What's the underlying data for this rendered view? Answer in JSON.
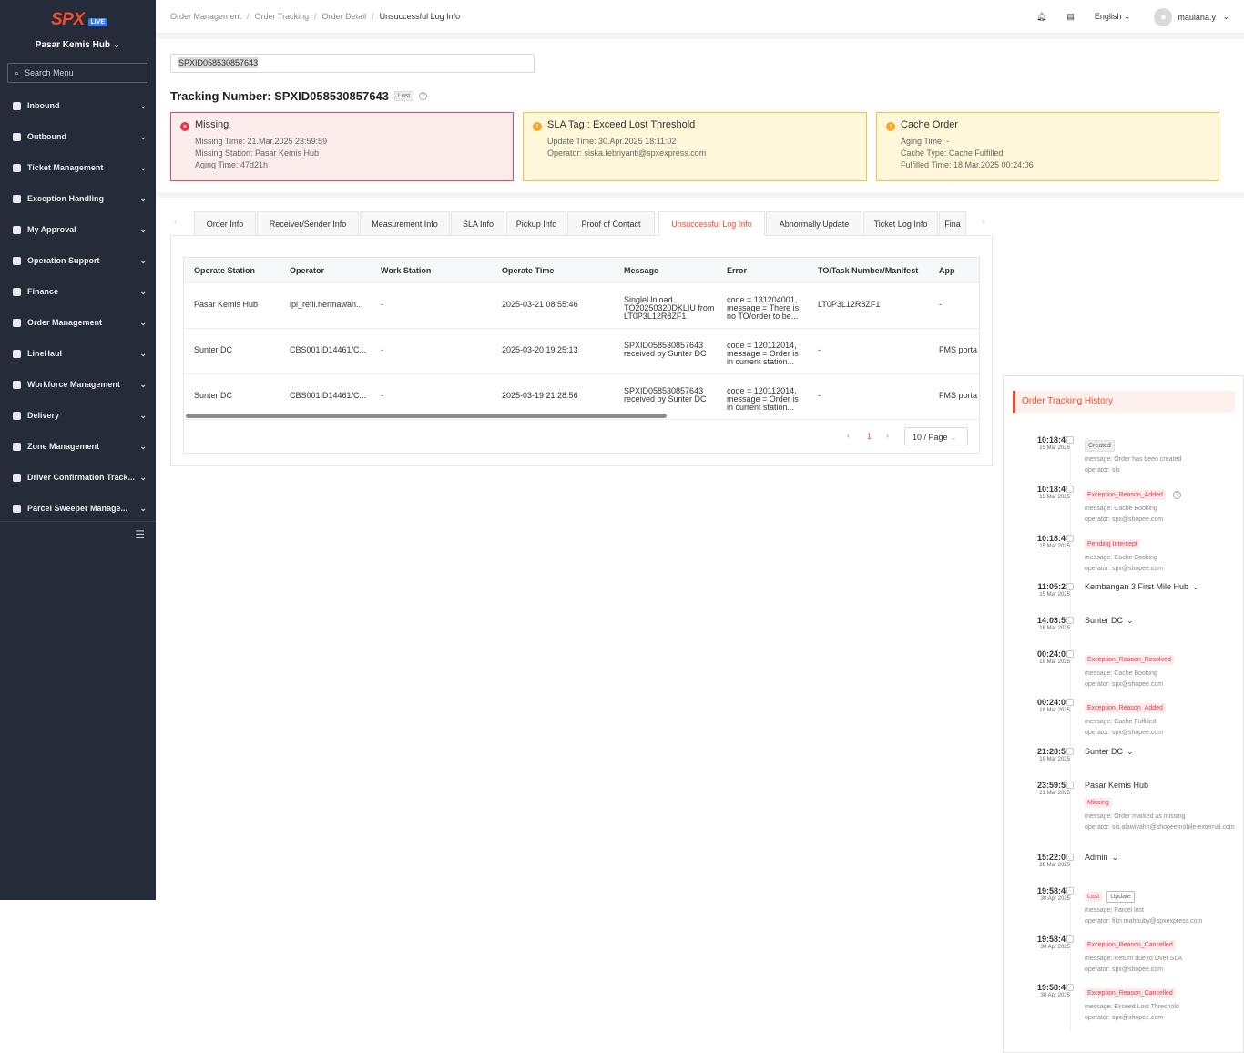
{
  "sidebar": {
    "logo": "SPX",
    "live": "LIVE",
    "hub": "Pasar Kemis Hub",
    "search_placeholder": "Search Menu",
    "items": [
      "Inbound",
      "Outbound",
      "Ticket Management",
      "Exception Handling",
      "My Approval",
      "Operation Support",
      "Finance",
      "Order Management",
      "LineHaul",
      "Workforce Management",
      "Delivery",
      "Zone Management",
      "Driver Confirmation Track...",
      "Parcel Sweeper Manage..."
    ]
  },
  "header": {
    "breadcrumbs": [
      "Order Management",
      "Order Tracking",
      "Order Detail",
      "Unsuccessful Log Info"
    ],
    "language": "English",
    "user": "maulana.y"
  },
  "tracking": {
    "search_value": "SPXID058530857643",
    "label": "Tracking Number: SPXID058530857643",
    "tag": "Lost"
  },
  "cards": [
    {
      "title": "Missing",
      "lines": [
        "Missing Time: 21.Mar.2025 23:59:59",
        "Missing Station: Pasar Kemis Hub",
        "Aging Time: 47d21h"
      ]
    },
    {
      "title": "SLA Tag : Exceed Lost Threshold",
      "lines": [
        "Update Time: 30.Apr.2025 18:11:02",
        "Operator: siska.febriyanti@spxexpress.com"
      ]
    },
    {
      "title": "Cache Order",
      "lines": [
        "Aging Time: -",
        "Cache Type: Cache Fulfilled",
        "Fulfilled Time: 18.Mar.2025 00:24:06"
      ]
    }
  ],
  "tabs": [
    "Order Info",
    "Receiver/Sender Info",
    "Measurement Info",
    "SLA Info",
    "Pickup Info",
    "Proof of Contact",
    "Unsuccessful Log Info",
    "Abnormally Update",
    "Ticket Log Info",
    "Fina"
  ],
  "table": {
    "headers": [
      "Operate Station",
      "Operator",
      "Work Station",
      "Operate Time",
      "Message",
      "Error",
      "TO/Task Number/Manifest",
      "App"
    ],
    "rows": [
      [
        "Pasar Kemis Hub",
        "ipi_refli.hermawan...",
        "-",
        "2025-03-21 08:55:46",
        "SingleUnload TO20250320DKLIU from LT0P3L12R8ZF1",
        "code = 131204001, message = There is no TO/order to be...",
        "LT0P3L12R8ZF1",
        "-"
      ],
      [
        "Sunter DC",
        "CBS001ID14461/C...",
        "-",
        "2025-03-20 19:25:13",
        "SPXID058530857643 received by Sunter DC",
        "code = 120112014, message = Order is in current station...",
        "-",
        "FMS porta"
      ],
      [
        "Sunter DC",
        "CBS001ID14461/C...",
        "-",
        "2025-03-19 21:28:56",
        "SPXID058530857643 received by Sunter DC",
        "code = 120112014, message = Order is in current station...",
        "-",
        "FMS porta"
      ]
    ]
  },
  "pagination": {
    "page": "1",
    "per_page": "10 / Page"
  },
  "history": {
    "title": "Order Tracking History",
    "events": [
      {
        "time": "10:18:47",
        "date": "15 Mar 2025",
        "badge": "Created",
        "badge_style": "gray",
        "lines": [
          "message: Order has been created",
          "operator: sls"
        ]
      },
      {
        "time": "10:18:47",
        "date": "15 Mar 2025",
        "badge": "Exception_Reason_Added",
        "badge_style": "red",
        "lines": [
          "message: Cache Booking",
          "operator: spx@shopee.com"
        ]
      },
      {
        "time": "10:18:47",
        "date": "15 Mar 2025",
        "badge": "Pending Intercept",
        "badge_style": "red",
        "lines": [
          "message: Cache Booking",
          "operator: spx@shopee.com"
        ]
      },
      {
        "time": "11:05:25",
        "date": "15 Mar 2025",
        "location": "Kembangan 3 First Mile Hub",
        "lines": []
      },
      {
        "time": "14:03:59",
        "date": "16 Mar 2025",
        "location": "Sunter DC",
        "lines": []
      },
      {
        "time": "00:24:06",
        "date": "18 Mar 2025",
        "badge": "Exception_Reason_Resolved",
        "badge_style": "red",
        "lines": [
          "message: Cache Booking",
          "operator: spx@shopee.com"
        ]
      },
      {
        "time": "00:24:06",
        "date": "18 Mar 2025",
        "badge": "Exception_Reason_Added",
        "badge_style": "red",
        "lines": [
          "message: Cache Fulfilled",
          "operator: spx@shopee.com"
        ]
      },
      {
        "time": "21:28:56",
        "date": "19 Mar 2025",
        "location": "Sunter DC",
        "lines": []
      },
      {
        "time": "23:59:59",
        "date": "21 Mar 2025",
        "location": "Pasar Kemis Hub",
        "badge": "Missing",
        "badge_style": "red",
        "lines": [
          "message: Order marked as missing",
          "operator: siti.alawiyahh@shopeemobile-external.com"
        ]
      },
      {
        "time": "15:22:08",
        "date": "28 Mar 2025",
        "location": "Admin",
        "lines": []
      },
      {
        "time": "19:58:49",
        "date": "30 Apr 2025",
        "badge": "Lost",
        "badge_style": "red",
        "badge2": "Update",
        "lines": [
          "message: Parcel lost",
          "operator: fikri.mahbuby@spxexpress.com"
        ]
      },
      {
        "time": "19:58:49",
        "date": "30 Apr 2025",
        "badge": "Exception_Reason_Cancelled",
        "badge_style": "red",
        "lines": [
          "message: Return due to Over SLA",
          "operator: spx@shopee.com"
        ]
      },
      {
        "time": "19:58:49",
        "date": "30 Apr 2025",
        "badge": "Exception_Reason_Cancelled",
        "badge_style": "red",
        "lines": [
          "message: Exceed Lost Threshold",
          "operator: spx@shopee.com"
        ]
      }
    ]
  }
}
